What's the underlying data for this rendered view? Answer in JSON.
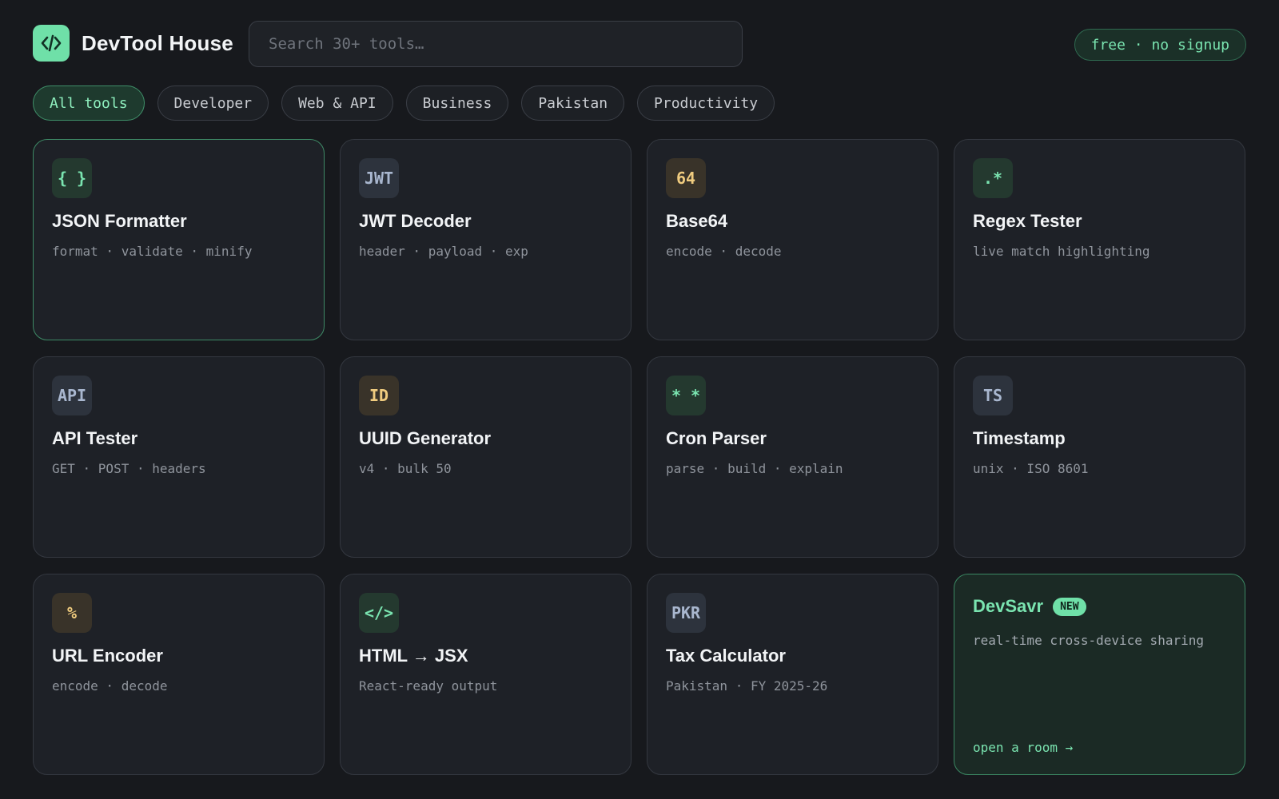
{
  "brand": {
    "name": "DevTool House",
    "logo_glyph": "</>"
  },
  "search": {
    "placeholder": "Search 30+ tools…",
    "value": ""
  },
  "badge": {
    "label": "free · no signup"
  },
  "filters": [
    {
      "label": "All tools",
      "active": true
    },
    {
      "label": "Developer",
      "active": false
    },
    {
      "label": "Web & API",
      "active": false
    },
    {
      "label": "Business",
      "active": false
    },
    {
      "label": "Pakistan",
      "active": false
    },
    {
      "label": "Productivity",
      "active": false
    }
  ],
  "tools": [
    {
      "icon": "{ }",
      "icon_name": "braces-icon",
      "tone": "green",
      "title": "JSON Formatter",
      "subtitle": "format · validate · minify"
    },
    {
      "icon": "JWT",
      "icon_name": "jwt-icon",
      "tone": "slate",
      "title": "JWT Decoder",
      "subtitle": "header · payload · exp"
    },
    {
      "icon": "64",
      "icon_name": "base64-icon",
      "tone": "amber",
      "title": "Base64",
      "subtitle": "encode · decode"
    },
    {
      "icon": ".*",
      "icon_name": "regex-icon",
      "tone": "green",
      "title": "Regex Tester",
      "subtitle": "live match highlighting"
    },
    {
      "icon": "API",
      "icon_name": "api-icon",
      "tone": "slate",
      "title": "API Tester",
      "subtitle": "GET · POST · headers"
    },
    {
      "icon": "ID",
      "icon_name": "id-icon",
      "tone": "amber",
      "title": "UUID Generator",
      "subtitle": "v4 · bulk 50"
    },
    {
      "icon": "* *",
      "icon_name": "asterisks-icon",
      "tone": "green",
      "title": "Cron Parser",
      "subtitle": "parse · build · explain"
    },
    {
      "icon": "TS",
      "icon_name": "timestamp-icon",
      "tone": "slate",
      "title": "Timestamp",
      "subtitle": "unix · ISO 8601"
    },
    {
      "icon": "%",
      "icon_name": "percent-icon",
      "tone": "amber",
      "title": "URL Encoder",
      "subtitle": "encode · decode"
    },
    {
      "icon": "</>",
      "icon_name": "code-tag-icon",
      "tone": "green",
      "title": "HTML → JSX",
      "subtitle": "React-ready output"
    },
    {
      "icon": "PKR",
      "icon_name": "pkr-icon",
      "tone": "slate",
      "title": "Tax Calculator",
      "subtitle": "Pakistan · FY 2025-26"
    }
  ],
  "promo": {
    "title": "DevSavr",
    "badge": "NEW",
    "subtitle": "real-time cross-device sharing",
    "link": "open a room →"
  },
  "colors": {
    "background": "#17191d",
    "card": "#1e2127",
    "accent": "#7ae4b0",
    "accent_solid": "#6fe0a8",
    "amber": "#f0cc7f",
    "slate": "#a9b7cf"
  }
}
